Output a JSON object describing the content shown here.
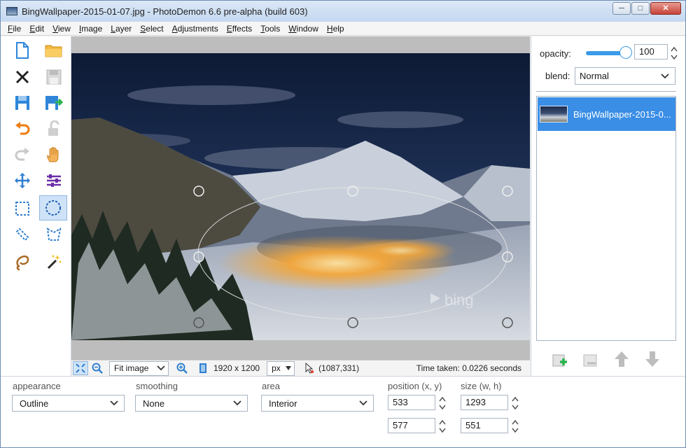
{
  "window": {
    "title": "BingWallpaper-2015-01-07.jpg  -  PhotoDemon 6.6 pre-alpha (build 603)",
    "controls": {
      "minimize": "─",
      "maximize": "□",
      "close": "✕"
    }
  },
  "menu": [
    "File",
    "Edit",
    "View",
    "Image",
    "Layer",
    "Select",
    "Adjustments",
    "Effects",
    "Tools",
    "Window",
    "Help"
  ],
  "toolbox": {
    "tools": [
      "new-file-icon",
      "open-folder-icon",
      "close-icon",
      "save-icon",
      "save-as-icon",
      "export-icon",
      "undo-icon",
      "lock-icon",
      "redo-icon",
      "hand-pan-icon",
      "move-icon",
      "adjust-sliders-icon",
      "rect-select-icon",
      "ellipse-select-icon",
      "line-select-icon",
      "polygon-select-icon",
      "lasso-select-icon",
      "magic-wand-icon"
    ],
    "active_tool": "ellipse-select-icon"
  },
  "canvas": {
    "watermark": "bing"
  },
  "status": {
    "zoom_mode": "Fit image",
    "image_size": "1920 x 1200",
    "unit": "px",
    "cursor_pos": "(1087,331)",
    "time_taken": "Time taken: 0.0226 seconds"
  },
  "layers_panel": {
    "opacity_label": "opacity:",
    "opacity_value": "100",
    "opacity_level": 1.0,
    "blend_label": "blend:",
    "blend_value": "Normal",
    "layers": [
      {
        "name": "BingWallpaper-2015-0...",
        "selected": true
      }
    ],
    "accent": "#3a8ee6"
  },
  "options": {
    "appearance_label": "appearance",
    "appearance_value": "Outline",
    "smoothing_label": "smoothing",
    "smoothing_value": "None",
    "area_label": "area",
    "area_value": "Interior",
    "position_label": "position (x, y)",
    "position_x": "533",
    "position_y": "577",
    "size_label": "size (w, h)",
    "size_w": "1293",
    "size_h": "551"
  }
}
